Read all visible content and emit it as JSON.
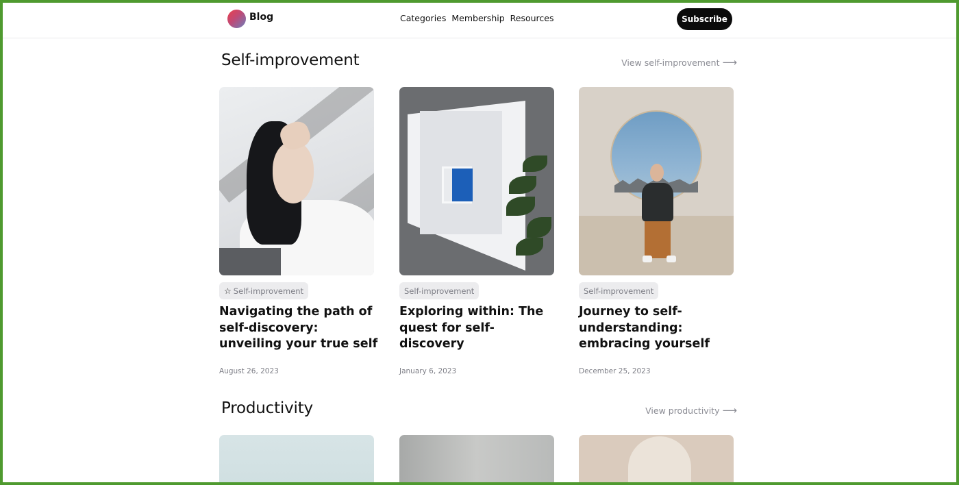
{
  "header": {
    "brand": "Blog",
    "nav": [
      "Categories",
      "Membership",
      "Resources"
    ],
    "subscribe_label": "Subscribe"
  },
  "sections": [
    {
      "title": "Self-improvement",
      "view_link": "View self-improvement",
      "posts": [
        {
          "tag": "Self-improvement",
          "title": "Navigating the path of self-discovery: unveiling your true self",
          "date": "August 26, 2023"
        },
        {
          "tag": "Self-improvement",
          "title": "Exploring within: The quest for self- discovery",
          "date": "January 6, 2023"
        },
        {
          "tag": "Self-improvement",
          "title": "Journey to self-understanding: embracing yourself",
          "date": "December 25, 2023"
        }
      ]
    },
    {
      "title": "Productivity",
      "view_link": "View productivity"
    }
  ],
  "icons": {
    "tag_icon": "star-icon",
    "link_icon": "arrow-right-icon"
  },
  "colors": {
    "accent_border": "#4f9a2f",
    "button_bg": "#0b0b0b",
    "muted_text": "#8a8b93",
    "tag_bg": "#ececee"
  }
}
